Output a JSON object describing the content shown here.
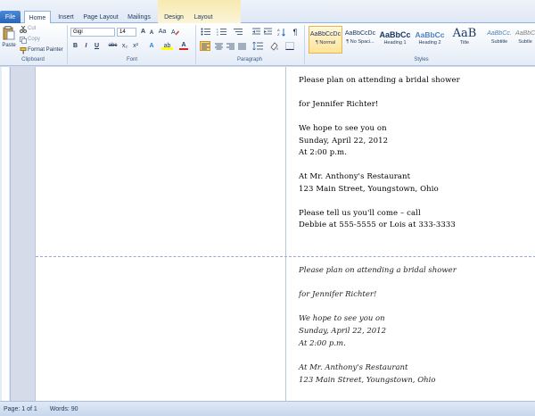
{
  "tabs": {
    "file": "File",
    "items": [
      "Home",
      "Insert",
      "Page Layout",
      "Mailings",
      "Design",
      "Layout"
    ],
    "active": "Home"
  },
  "clipboard": {
    "paste": "Paste",
    "cut": "Cut",
    "copy": "Copy",
    "format_painter": "Format Painter",
    "group": "Clipboard"
  },
  "font": {
    "family": "Gigi",
    "size": "14",
    "grow": "A",
    "shrink": "A",
    "aa": "Aa",
    "bold": "B",
    "italic": "I",
    "underline": "U",
    "strike": "abc",
    "sub": "x₂",
    "sup": "x²",
    "effects": "A",
    "highlight": "ab",
    "color": "A",
    "group": "Font"
  },
  "paragraph": {
    "pilcrow": "¶",
    "group": "Paragraph"
  },
  "styles": {
    "items": [
      {
        "sample": "AaBbCcDc",
        "name": "¶ Normal"
      },
      {
        "sample": "AaBbCcDc",
        "name": "¶ No Spaci..."
      },
      {
        "sample": "AaBbCc",
        "name": "Heading 1"
      },
      {
        "sample": "AaBbCc",
        "name": "Heading 2"
      },
      {
        "sample": "AaB",
        "name": "Title"
      },
      {
        "sample": "AaBbCc.",
        "name": "Subtitle"
      },
      {
        "sample": "AaBbCc",
        "name": "Subtle"
      }
    ],
    "group": "Styles"
  },
  "document": {
    "card_top": [
      "Please plan on attending a bridal shower",
      "",
      "for Jennifer Richter!",
      "",
      "We hope to see you on",
      "Sunday, April 22, 2012",
      "At 2:00 p.m.",
      "",
      "At Mr. Anthony's Restaurant",
      "123 Main Street, Youngstown, Ohio",
      "",
      "Please tell us you'll come – call",
      "Debbie at 555-5555 or Lois at 333-3333"
    ],
    "card_bottom": [
      "Please plan on attending a bridal shower",
      "",
      "for Jennifer Richter!",
      "",
      "We hope to see you on",
      "Sunday, April 22, 2012",
      "At 2:00 p.m.",
      "",
      "At Mr. Anthony's Restaurant",
      "123 Main Street, Youngstown, Ohio"
    ]
  },
  "status": {
    "page": "Page: 1 of 1",
    "words": "Words: 90"
  },
  "colors": {
    "file_tab": "#2a64b8",
    "ribbon_bg": "#e4ecf7",
    "context_tab_bg": "#f7e9b0",
    "selected_style": "#ffe39a",
    "fold_line": "#9aa6d8"
  },
  "icons": [
    "paste-icon",
    "cut-icon",
    "copy-icon",
    "format-painter-icon",
    "bullets-icon",
    "numbering-icon",
    "multilevel-icon",
    "align-left-icon",
    "align-center-icon",
    "align-right-icon",
    "justify-icon",
    "line-spacing-icon",
    "shading-icon",
    "borders-icon",
    "sort-icon"
  ]
}
